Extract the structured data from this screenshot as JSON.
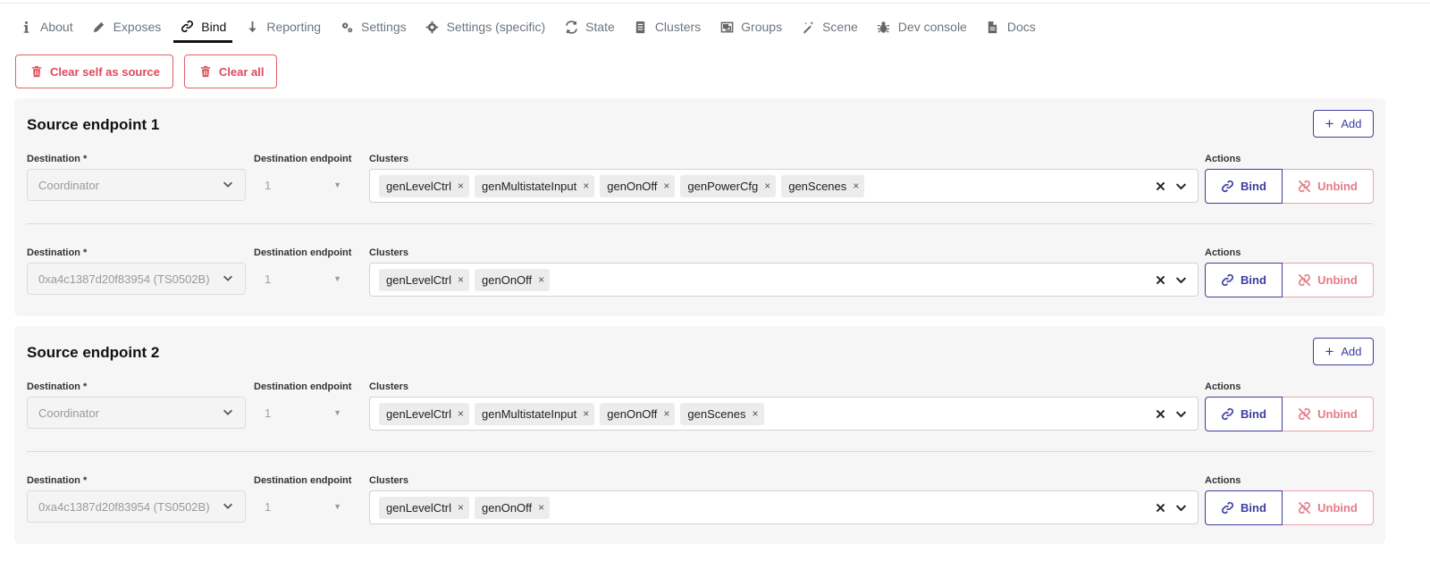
{
  "tabs": [
    {
      "label": "About",
      "icon": "info-icon"
    },
    {
      "label": "Exposes",
      "icon": "pencil-icon"
    },
    {
      "label": "Bind",
      "icon": "link-icon",
      "active": true
    },
    {
      "label": "Reporting",
      "icon": "arrow-down-icon"
    },
    {
      "label": "Settings",
      "icon": "cogs-icon"
    },
    {
      "label": "Settings (specific)",
      "icon": "gear-icon"
    },
    {
      "label": "State",
      "icon": "sync-icon"
    },
    {
      "label": "Clusters",
      "icon": "server-icon"
    },
    {
      "label": "Groups",
      "icon": "object-group-icon"
    },
    {
      "label": "Scene",
      "icon": "magic-wand-icon"
    },
    {
      "label": "Dev console",
      "icon": "bug-icon"
    },
    {
      "label": "Docs",
      "icon": "file-icon"
    }
  ],
  "actions": {
    "clear_self": "Clear self as source",
    "clear_all": "Clear all"
  },
  "labels": {
    "destination": "Destination *",
    "destination_endpoint": "Destination endpoint",
    "clusters": "Clusters",
    "actions": "Actions",
    "add": "Add",
    "bind": "Bind",
    "unbind": "Unbind"
  },
  "endpoints": [
    {
      "title": "Source endpoint 1",
      "rows": [
        {
          "destination": "Coordinator",
          "endpoint": "1",
          "clusters": [
            "genLevelCtrl",
            "genMultistateInput",
            "genOnOff",
            "genPowerCfg",
            "genScenes"
          ]
        },
        {
          "destination": "0xa4c1387d20f83954 (TS0502B)",
          "endpoint": "1",
          "clusters": [
            "genLevelCtrl",
            "genOnOff"
          ]
        }
      ]
    },
    {
      "title": "Source endpoint 2",
      "rows": [
        {
          "destination": "Coordinator",
          "endpoint": "1",
          "clusters": [
            "genLevelCtrl",
            "genMultistateInput",
            "genOnOff",
            "genScenes"
          ]
        },
        {
          "destination": "0xa4c1387d20f83954 (TS0502B)",
          "endpoint": "1",
          "clusters": [
            "genLevelCtrl",
            "genOnOff"
          ]
        }
      ]
    }
  ],
  "colors": {
    "primary": "#3d3d9e",
    "danger": "#dc4a5b",
    "card_bg": "#f6f6f6"
  }
}
